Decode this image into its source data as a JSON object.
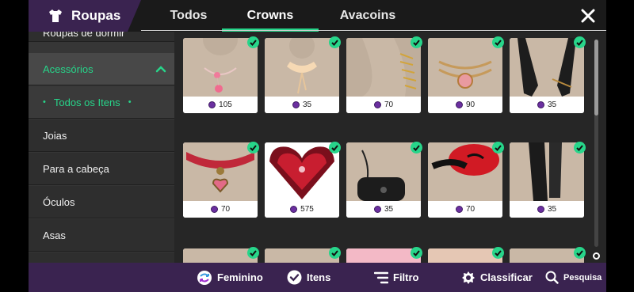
{
  "header": {
    "title": "Roupas",
    "tabs": [
      {
        "label": "Todos"
      },
      {
        "label": "Crowns"
      },
      {
        "label": "Avacoins"
      }
    ],
    "active_tab": "Crowns"
  },
  "sidebar": {
    "items": [
      {
        "label": "Roupas de dormir"
      },
      {
        "label": "Acessórios"
      },
      {
        "label": "Todos os Itens"
      },
      {
        "label": "Joias"
      },
      {
        "label": "Para a cabeça"
      },
      {
        "label": "Óculos"
      },
      {
        "label": "Asas"
      }
    ]
  },
  "items": [
    {
      "price": "105",
      "icon": "choker-necklace-icon"
    },
    {
      "price": "35",
      "icon": "bow-collar-icon"
    },
    {
      "price": "70",
      "icon": "arm-bracelet-icon"
    },
    {
      "price": "90",
      "icon": "gold-choker-icon"
    },
    {
      "price": "35",
      "icon": "black-gloves-icon"
    },
    {
      "price": "70",
      "icon": "red-collar-heart-icon"
    },
    {
      "price": "575",
      "icon": "heart-wings-icon"
    },
    {
      "price": "35",
      "icon": "black-bag-icon"
    },
    {
      "price": "70",
      "icon": "red-cap-icon"
    },
    {
      "price": "35",
      "icon": "black-scarf-icon"
    }
  ],
  "bottom_bar": {
    "feminine": "Feminino",
    "items": "Itens",
    "filter": "Filtro",
    "sort": "Classificar",
    "search": "Pesquisa"
  },
  "colors": {
    "accent": "#27d58a",
    "brand_purple": "#3a2350",
    "coin": "#6b2fa0"
  }
}
